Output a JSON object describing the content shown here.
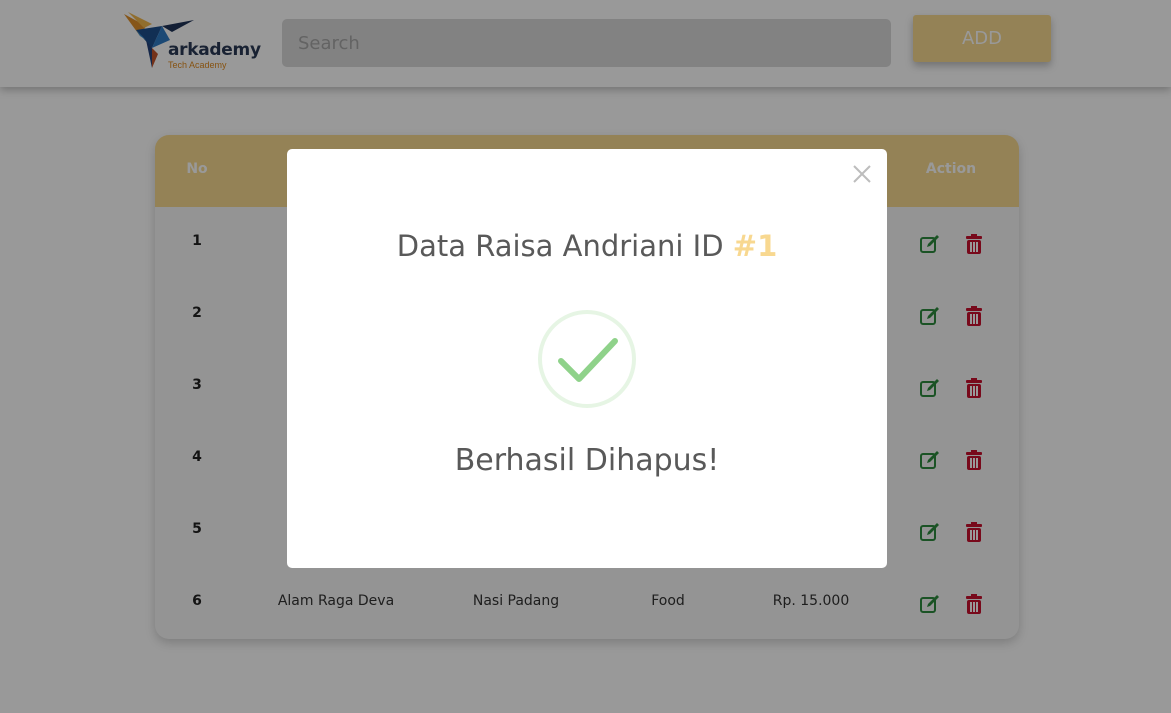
{
  "header": {
    "logo_text": "arkademy",
    "logo_subtext": "Tech Academy",
    "search_placeholder": "Search",
    "add_label": "ADD"
  },
  "table": {
    "columns": [
      "No",
      "Action"
    ],
    "rows": [
      {
        "no": "1",
        "name": "",
        "product": "",
        "category": "",
        "price": ""
      },
      {
        "no": "2",
        "name": "",
        "product": "",
        "category": "",
        "price": ""
      },
      {
        "no": "3",
        "name": "",
        "product": "",
        "category": "",
        "price": ""
      },
      {
        "no": "4",
        "name": "",
        "product": "",
        "category": "",
        "price": ""
      },
      {
        "no": "5",
        "name": "",
        "product": "",
        "category": "",
        "price": ""
      },
      {
        "no": "6",
        "name": "Alam Raga Deva",
        "product": "Nasi Padang",
        "category": "Food",
        "price": "Rp. 15.000"
      }
    ]
  },
  "modal": {
    "title_prefix": "Data Raisa Andriani ID ",
    "title_id": "#1",
    "message": "Berhasil Dihapus!"
  },
  "icons": {
    "edit": "edit-icon",
    "delete": "trash-icon",
    "close": "close-icon",
    "success": "check-icon"
  },
  "colors": {
    "accent": "#f7d98f",
    "edit": "#2e8b3e",
    "delete": "#c8102e",
    "success": "#8fd28a"
  }
}
